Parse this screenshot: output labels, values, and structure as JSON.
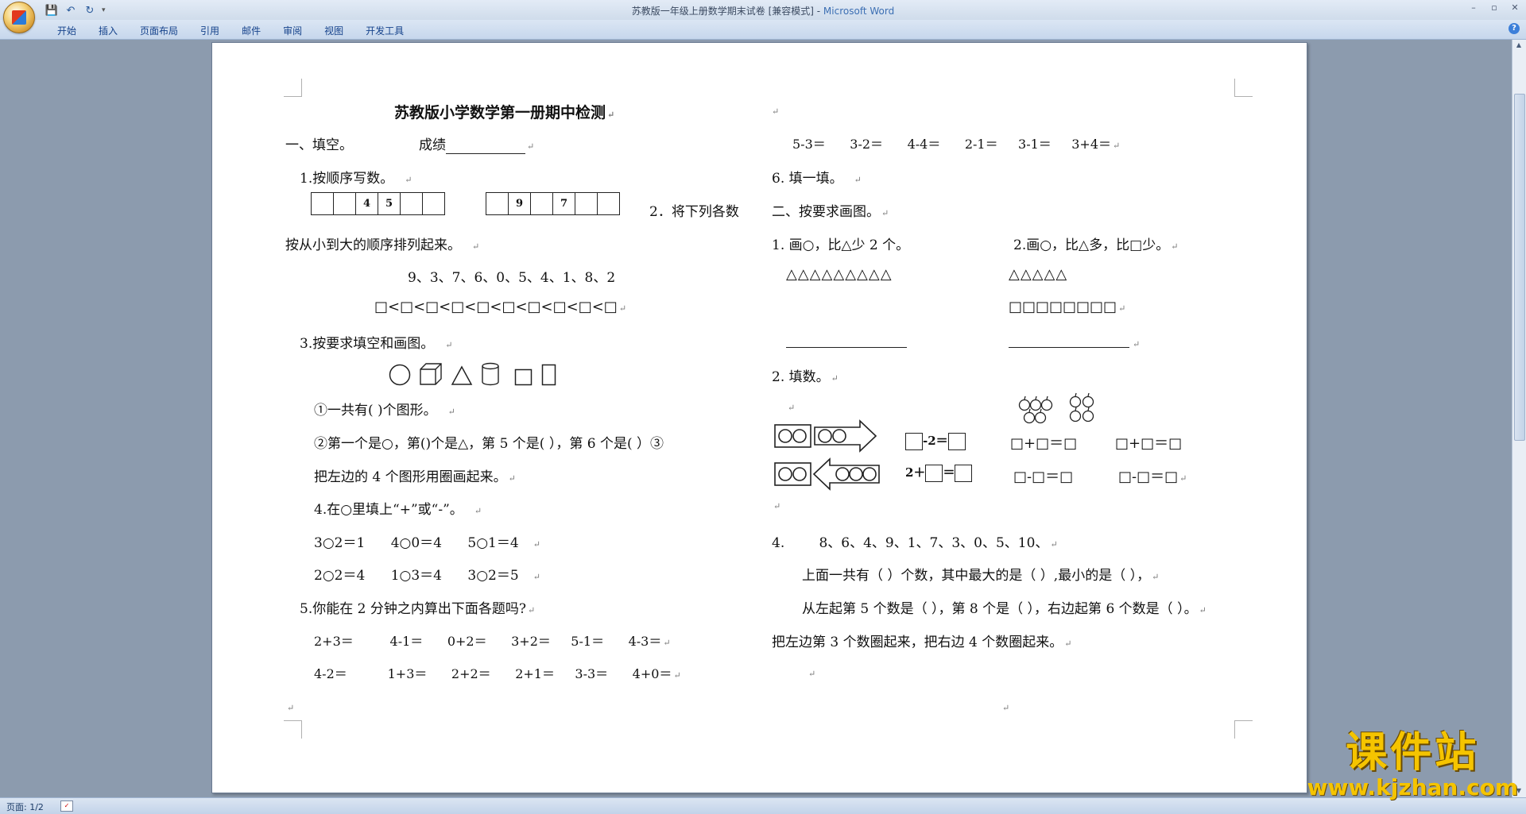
{
  "window": {
    "title_prefix": "苏教版一年级上册数学期末试卷 [兼容模式] - ",
    "title_app": "Microsoft Word",
    "minimize": "–",
    "maximize": "▫",
    "close": "✕"
  },
  "qat": {
    "save_icon": "💾",
    "undo_icon": "↶",
    "redo_icon": "↻",
    "more": "▾"
  },
  "ribbon": {
    "tabs": [
      "开始",
      "插入",
      "页面布局",
      "引用",
      "邮件",
      "审阅",
      "视图",
      "开发工具"
    ],
    "help": "?"
  },
  "status": {
    "page_info": "页面: 1/2"
  },
  "doc": {
    "title": "苏教版小学数学第一册期中检测",
    "fill_head": "一、填空。",
    "score_label": "成绩",
    "q1": "1.按顺序写数。",
    "seq1": [
      "",
      "",
      "4",
      "5",
      "",
      "",
      ""
    ],
    "seq2": [
      "",
      "9",
      "",
      "7",
      "",
      "",
      ""
    ],
    "q2_head": "2．将下列各数",
    "q2_cont": "按从小到大的顺序排列起来。",
    "q2_nums": "9、3、7、6、0、5、4、1、8、2",
    "q2_boxes": "□<□<□<□<□<□<□<□<□<□",
    "q3": "3.按要求填空和画图。",
    "q3_a": "①一共有(  )个图形。",
    "q3_b": "②第一个是○，第()个是△，第 5 个是(    ），第 6 个是(     ）③",
    "q3_c": "把左边的 4 个图形用圈画起来。",
    "q4": "4.在○里填上“+”或“-”。",
    "q4_r1": "3○2＝1      4○0＝4      5○1＝4",
    "q4_r2": "2○2＝4      1○3＝4      3○2＝5",
    "q5": "5.你能在 2 分钟之内算出下面各题吗?",
    "q5_r1": "2+3＝         4-1＝      0+2＝      3+2＝     5-1＝      4-3＝",
    "q5_r2": "4-2＝          1+3＝      2+2＝      2+1＝     3-3＝      4+0＝",
    "r_calc": "5-3＝      3-2＝      4-4＝      2-1＝     3-1＝     3+4＝",
    "r_q6": "6. 填一填。",
    "r_sec2": "二、按要求画图。",
    "r_d1": "1. 画○，比△少 2 个。",
    "r_d2": "2.画○，比△多，比□少。",
    "r_tri1": "△△△△△△△△△",
    "r_tri2": "△△△△△",
    "r_sq": "□□□□□□□□",
    "r_fill": "2. 填数。",
    "r_minus2": "-2＝",
    "r_plus2": "2＋",
    "r_eq": "＝",
    "r_e1": "□+□＝□",
    "r_e2": "□+□＝□",
    "r_e3": "□-□＝□",
    "r_e4": "□-□＝□",
    "r_q4": "4.        8、6、4、9、1、7、3、0、5、10、",
    "r_q4a": "上面一共有（  ）个数，其中最大的是（  ）,最小的是（  ），",
    "r_q4b": "从左起第 5 个数是（  ），第 8 个是（  ），右边起第 6 个数是（  ）。",
    "r_q4c": "把左边第 3 个数圈起来，把右边 4 个数圈起来。",
    "para": "↵"
  },
  "watermark": {
    "brand": "课件站",
    "url": "www.kjzhan.com"
  }
}
